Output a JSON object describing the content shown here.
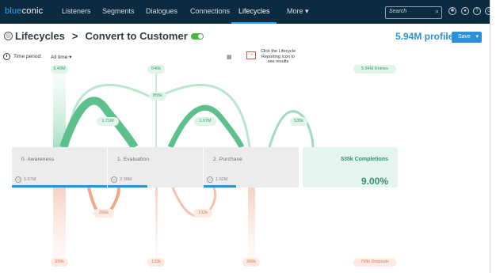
{
  "app": {
    "logo_prefix": "blue",
    "logo_suffix": "conic"
  },
  "nav": {
    "items": [
      {
        "label": "Listeners"
      },
      {
        "label": "Segments"
      },
      {
        "label": "Dialogues"
      },
      {
        "label": "Connections"
      },
      {
        "label": "Lifecycles"
      },
      {
        "label": "More ▾"
      }
    ],
    "active": "Lifecycles",
    "search_placeholder": "Search"
  },
  "header": {
    "section": "Lifecycles",
    "separator": ">",
    "name": "Convert to Customer",
    "profiles": "5.94M profiles",
    "save_label": "Save",
    "toggle_on": true
  },
  "toolbar": {
    "time_period_label": "Time period:",
    "time_period_value": "All time",
    "hint": "Click the Lifecycle Reporting Icon to see results"
  },
  "stages": [
    {
      "name": "0.  Awareness",
      "profiles": "5.67M",
      "progress": 1.0
    },
    {
      "name": "1.  Evaluation",
      "profiles": "2.38M",
      "progress": 0.42
    },
    {
      "name": "2.  Purchase",
      "profiles": "1.92M",
      "progress": 0.34
    }
  ],
  "completion": {
    "label": "535k  Completions",
    "percent": "9.00%"
  },
  "flows": {
    "entries": [
      "5.40M",
      "540k"
    ],
    "total_entries": "5.94M Entries",
    "transitions": [
      "855k",
      "1.71M",
      "1.07M",
      "535k"
    ],
    "backward": [
      "266k",
      "132k"
    ],
    "dropouts": [
      "399k",
      "133k",
      "266k"
    ],
    "total_dropouts": "799k Dropouts"
  },
  "colors": {
    "nav_bg": "#0b2b40",
    "accent": "#2d8fd6",
    "green": "#3a9a6a",
    "orange": "#d07a5c"
  }
}
